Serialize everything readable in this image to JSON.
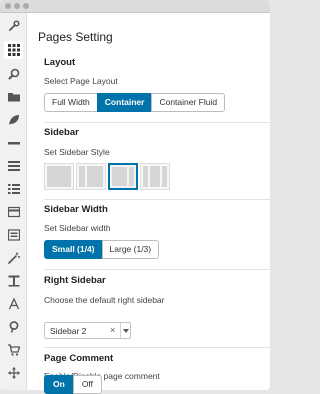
{
  "page": {
    "title": "Pages Setting"
  },
  "sidebar_icons": [
    "wrench-icon",
    "grid-icon",
    "search-icon",
    "folder-icon",
    "leaf-icon",
    "minus-icon",
    "menu-icon",
    "list-icon",
    "card-icon",
    "image-icon",
    "magic-wand-icon",
    "text-icon",
    "font-icon",
    "pin-icon",
    "cart-icon",
    "move-icon"
  ],
  "layout": {
    "title": "Layout",
    "description": "Select Page Layout",
    "options": [
      "Full Width",
      "Container",
      "Container Fluid"
    ],
    "selected": "Container"
  },
  "sidebar": {
    "title": "Sidebar",
    "description": "Set Sidebar Style",
    "selected_index": 2
  },
  "sidebar_width": {
    "title": "Sidebar Width",
    "description": "Set Sidebar width",
    "options": [
      "Small (1/4)",
      "Large (1/3)"
    ],
    "selected": "Small (1/4)"
  },
  "right_sidebar": {
    "title": "Right Sidebar",
    "description": "Choose the default right sidebar",
    "value": "Sidebar 2",
    "clear": "×"
  },
  "page_comment": {
    "title": "Page Comment",
    "description": "Enable/Disable page comment",
    "options": [
      "On",
      "Off"
    ],
    "selected": "On"
  },
  "colors": {
    "accent": "#0073aa",
    "sidebar_bg": "#f1f1f1",
    "icon": "#555555"
  }
}
